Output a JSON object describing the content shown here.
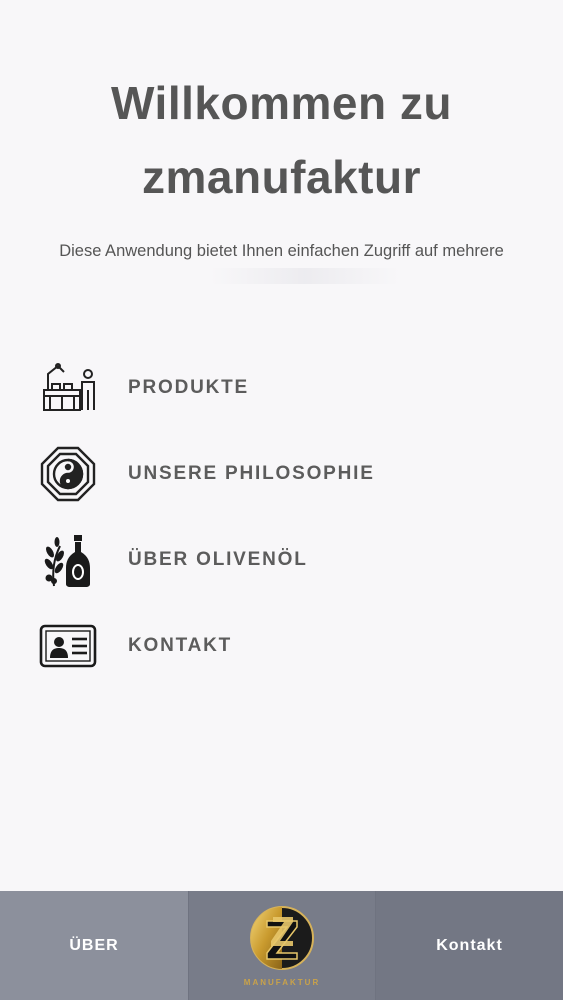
{
  "header": {
    "title_line1": "Willkommen zu",
    "title_line2": "zmanufaktur",
    "intro": "Diese Anwendung bietet Ihnen einfachen Zugriff auf mehrere"
  },
  "menu": {
    "items": [
      {
        "label": "PRODUKTE",
        "icon": "factory-icon"
      },
      {
        "label": "UNSERE PHILOSOPHIE",
        "icon": "yin-yang-icon"
      },
      {
        "label": "ÜBER OLIVENÖL",
        "icon": "olive-oil-icon"
      },
      {
        "label": "KONTAKT",
        "icon": "id-card-icon"
      }
    ]
  },
  "footer": {
    "left_label": "ÜBER",
    "logo_text": "MANUFAKTUR",
    "right_label": "Kontakt"
  },
  "colors": {
    "background": "#f8f7f9",
    "footer_left": "#8c909c",
    "footer_mid": "#787c89",
    "footer_right": "#737784",
    "logo_gold": "#c9a24a"
  }
}
